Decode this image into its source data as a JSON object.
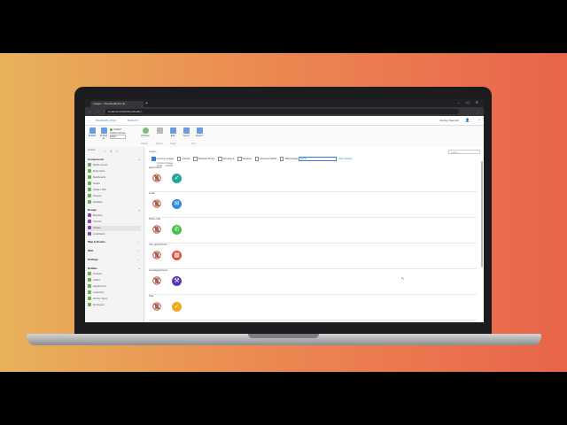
{
  "browser": {
    "tab_title": "Images - MoodlesBy113 [2]",
    "new_tab": "+",
    "url": "localhost:20010/MoodlesBy/..."
  },
  "header": {
    "back": "←",
    "app_name": "MoodlesBy (1/11)",
    "branch": "Default ▾",
    "user_name": "Andrey Kaerush",
    "help": "?"
  },
  "ribbon": {
    "publish": "Publish",
    "publish_as": "Publish As",
    "verify": "Verified",
    "publish_version": "Publish Version",
    "version_value": "latest",
    "preview": "Preview",
    "edit": "Edit",
    "import": "Import",
    "export": "Export",
    "groups": [
      "Publish",
      "Shared",
      "Image",
      "Files"
    ]
  },
  "sidebar": {
    "version_label": "Version",
    "version_value": "1",
    "components_label": "Components",
    "components": [
      "Mobile access",
      "Entity Store",
      "Dashboards",
      "Scripts",
      "OData / XML",
      "Process",
      "Variables"
    ],
    "design_label": "Design",
    "design": [
      "Branding",
      "Themes",
      "Images",
      "Localization"
    ],
    "maps_label": "Map & Routes",
    "web_label": "Web",
    "settings_label": "Settings",
    "entities_label": "Entities",
    "entities": [
      "Products",
      "Orders",
      "Appointment",
      "Customers",
      "Service Types",
      "Employees"
    ]
  },
  "content": {
    "images_label": "Images",
    "search_placeholder": "Search...",
    "filter_options": [
      "Common Images",
      "Android",
      "Windows Phone",
      "Windows 8",
      "Windows",
      "Windows Mobile",
      "Web"
    ],
    "display_label": "Display",
    "display_value": "Activity",
    "add_variation": "Add Variation",
    "col_common": "Common Images",
    "col_icon": "ICON",
    "col_size": "XXXDPI",
    "rows": [
      {
        "name": "appointment",
        "color": "#26a69a",
        "glyph": "✓"
      },
      {
        "name": "email",
        "color": "#2f8ae5",
        "glyph": "✉"
      },
      {
        "name": "Phone Call",
        "color": "#43c043",
        "glyph": "✆"
      },
      {
        "name": "new_appointment",
        "color": "#e24b35",
        "glyph": "▦"
      },
      {
        "name": "servicappointment",
        "color": "#5e35b1",
        "glyph": "⚒"
      },
      {
        "name": "Task",
        "color": "#f2a81d",
        "glyph": "✓"
      }
    ]
  },
  "colors": {
    "accent": "#3b7dd8",
    "background_left": "#e7b25a",
    "background_right": "#e8644a"
  }
}
